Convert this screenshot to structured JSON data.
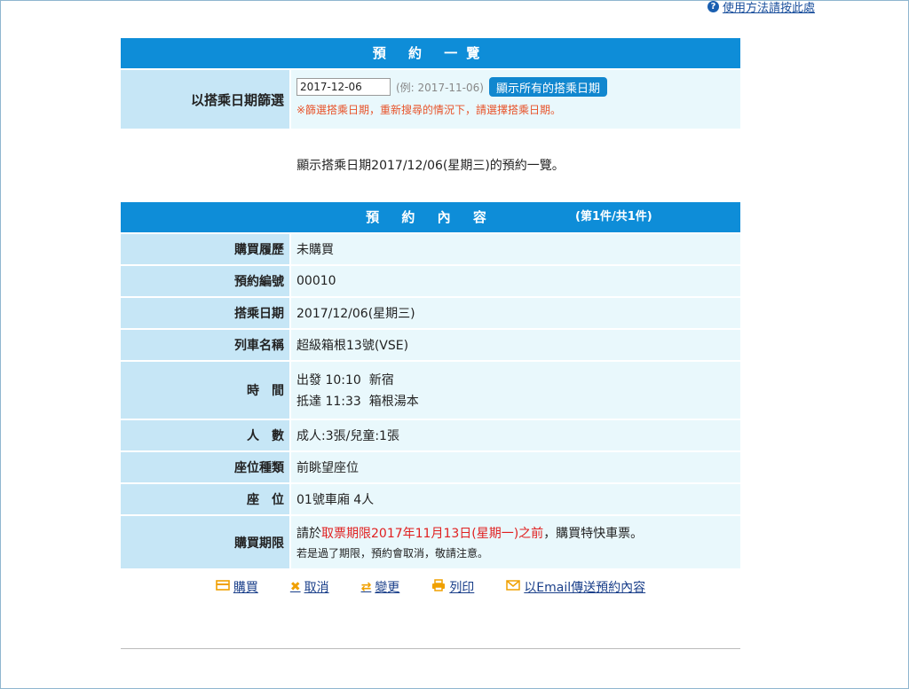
{
  "help": {
    "icon": "question-circle-icon",
    "label": "使用方法請按此處"
  },
  "list": {
    "header": "預 約 一覽",
    "filter_label": "以搭乘日期篩選",
    "date_value": "2017-12-06",
    "example": "(例: 2017-11-06)",
    "show_all": "顯示所有的搭乘日期",
    "note": "※篩選搭乘日期，重新搜尋的情況下，請選擇搭乘日期。"
  },
  "summary": "顯示搭乘日期2017/12/06(星期三)的預約一覽。",
  "detail": {
    "header": "預 約 內 容",
    "count": "(第1件/共1件)",
    "rows": {
      "history": {
        "label": "購買履歷",
        "value": "未購買"
      },
      "number": {
        "label": "預約編號",
        "value": "00010"
      },
      "date": {
        "label": "搭乘日期",
        "value": "2017/12/06(星期三)"
      },
      "train": {
        "label": "列車名稱",
        "value": "超級箱根13號(VSE)"
      },
      "time": {
        "label": "時間",
        "depart": "出發 10:10  新宿",
        "arrive": "抵達 11:33  箱根湯本"
      },
      "people": {
        "label": "人數",
        "value": "成人:3張/兒童:1張"
      },
      "seat_type": {
        "label": "座位種類",
        "value": "前眺望座位"
      },
      "seat": {
        "label": "座位",
        "value": "01號車廂 4人"
      },
      "deadline": {
        "label": "購買期限",
        "prefix": "請於",
        "highlight": "取票期限2017年11月13日(星期一)之前",
        "suffix": "，購買特快車票。",
        "note": "若是過了期限，預約會取消，敬請注意。"
      }
    }
  },
  "actions": [
    {
      "icon": "credit-card-icon",
      "label": "購買"
    },
    {
      "icon": "close-icon",
      "label": "取消"
    },
    {
      "icon": "swap-arrows-icon",
      "label": "變更"
    },
    {
      "icon": "printer-icon",
      "label": "列印"
    },
    {
      "icon": "envelope-icon",
      "label": "以Email傳送預約內容"
    }
  ]
}
